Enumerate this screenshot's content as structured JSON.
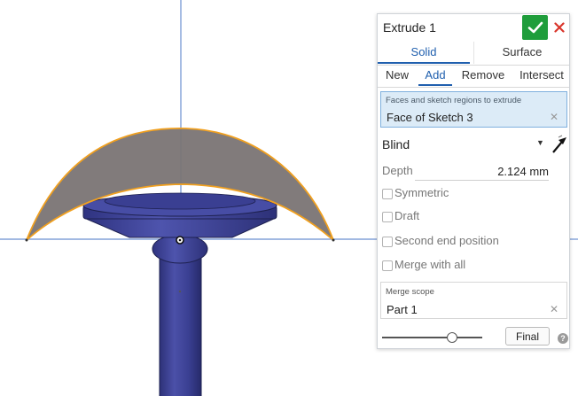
{
  "dialog": {
    "title": "Extrude 1",
    "confirm_icon": "checkmark-icon",
    "cancel_icon": "close-icon",
    "body_types": [
      {
        "label": "Solid",
        "active": true
      },
      {
        "label": "Surface",
        "active": false
      }
    ],
    "operations": [
      {
        "label": "New",
        "active": false
      },
      {
        "label": "Add",
        "active": true
      },
      {
        "label": "Remove",
        "active": false
      },
      {
        "label": "Intersect",
        "active": false
      }
    ],
    "faces": {
      "label": "Faces and sketch regions to extrude",
      "value": "Face of Sketch 3"
    },
    "end_type": {
      "value": "Blind"
    },
    "depth": {
      "label": "Depth",
      "value": "2.124 mm"
    },
    "options": [
      {
        "label": "Symmetric",
        "checked": false
      },
      {
        "label": "Draft",
        "checked": false
      },
      {
        "label": "Second end position",
        "checked": false
      },
      {
        "label": "Merge with all",
        "checked": false
      }
    ],
    "merge_scope": {
      "label": "Merge scope",
      "value": "Part 1"
    },
    "rollback": {
      "position": 0.7
    },
    "final_label": "Final",
    "help_glyph": "?"
  },
  "colors": {
    "confirm": "#1f9d3b",
    "cancel": "#d9352b",
    "active_tab": "#1f5fae",
    "selection_bg": "#dcebf7",
    "model_blue": "#3a3f92",
    "preview_gray": "#7a7474",
    "preview_edge": "#f0a020",
    "axis": "#6b8fd0"
  }
}
